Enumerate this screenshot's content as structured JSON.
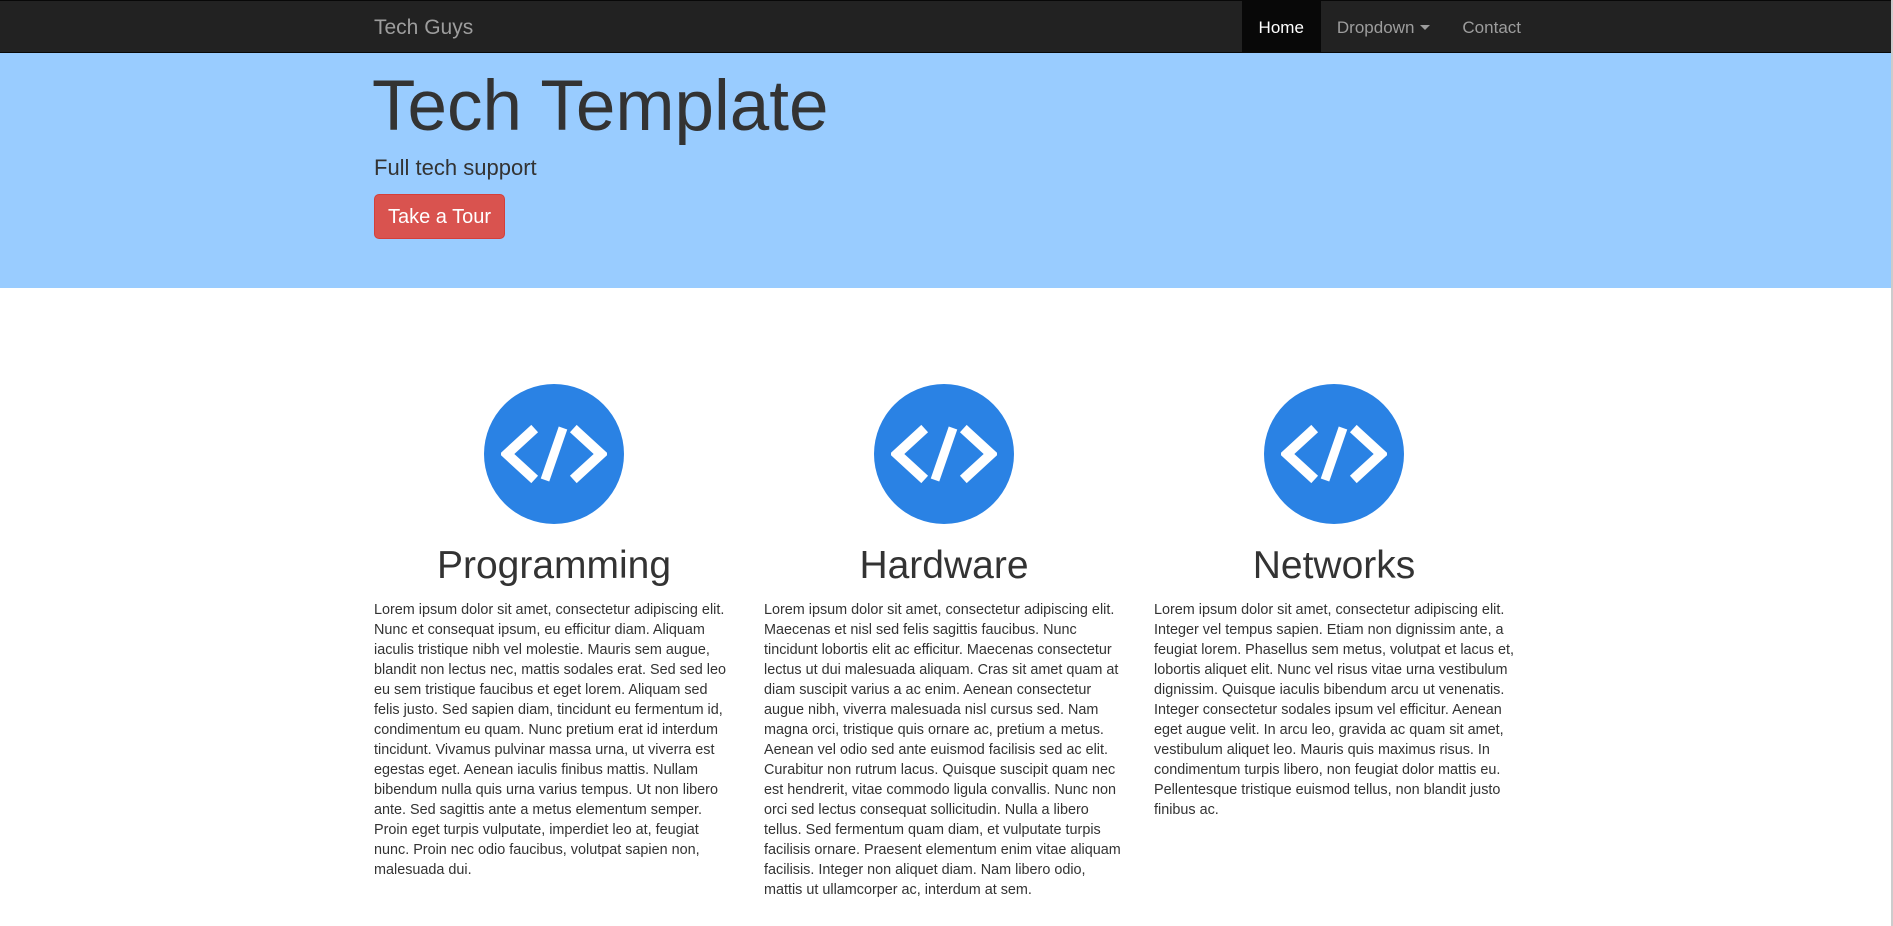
{
  "navbar": {
    "brand": "Tech Guys",
    "items": [
      {
        "label": "Home",
        "active": true
      },
      {
        "label": "Dropdown",
        "dropdown": true
      },
      {
        "label": "Contact"
      }
    ]
  },
  "hero": {
    "title": "Tech Template",
    "lead": "Full tech support",
    "button_label": "Take a Tour"
  },
  "colors": {
    "navbar_bg": "#222222",
    "hero_bg": "#99ccff",
    "button_bg": "#d9534f",
    "icon_bg": "#2a82e4"
  },
  "features": [
    {
      "icon": "code-icon",
      "title": "Programming",
      "text": "Lorem ipsum dolor sit amet, consectetur adipiscing elit. Nunc et consequat ipsum, eu efficitur diam. Aliquam iaculis tristique nibh vel molestie. Mauris sem augue, blandit non lectus nec, mattis sodales erat. Sed sed leo eu sem tristique faucibus et eget lorem. Aliquam sed felis justo. Sed sapien diam, tincidunt eu fermentum id, condimentum eu quam. Nunc pretium erat id interdum tincidunt. Vivamus pulvinar massa urna, ut viverra est egestas eget. Aenean iaculis finibus mattis. Nullam bibendum nulla quis urna varius tempus. Ut non libero ante. Sed sagittis ante a metus elementum semper. Proin eget turpis vulputate, imperdiet leo at, feugiat nunc. Proin nec odio faucibus, volutpat sapien non, malesuada dui."
    },
    {
      "icon": "code-icon",
      "title": "Hardware",
      "text": "Lorem ipsum dolor sit amet, consectetur adipiscing elit. Maecenas et nisl sed felis sagittis faucibus. Nunc tincidunt lobortis elit ac efficitur. Maecenas consectetur lectus ut dui malesuada aliquam. Cras sit amet quam at diam suscipit varius a ac enim. Aenean consectetur augue nibh, viverra malesuada nisl cursus sed. Nam magna orci, tristique quis ornare ac, pretium a metus. Aenean vel odio sed ante euismod facilisis sed ac elit. Curabitur non rutrum lacus. Quisque suscipit quam nec est hendrerit, vitae commodo ligula convallis. Nunc non orci sed lectus consequat sollicitudin. Nulla a libero tellus. Sed fermentum quam diam, et vulputate turpis facilisis ornare. Praesent elementum enim vitae aliquam facilisis. Integer non aliquet diam. Nam libero odio, mattis ut ullamcorper ac, interdum at sem."
    },
    {
      "icon": "code-icon",
      "title": "Networks",
      "text": "Lorem ipsum dolor sit amet, consectetur adipiscing elit. Integer vel tempus sapien. Etiam non dignissim ante, a feugiat lorem. Phasellus sem metus, volutpat et lacus et, lobortis aliquet elit. Nunc vel risus vitae urna vestibulum dignissim. Quisque iaculis bibendum arcu ut venenatis. Integer consectetur sodales ipsum vel efficitur. Aenean eget augue velit. In arcu leo, gravida ac quam sit amet, vestibulum aliquet leo. Mauris quis maximus risus. In condimentum turpis libero, non feugiat dolor mattis eu. Pellentesque tristique euismod tellus, non blandit justo finibus ac."
    }
  ]
}
